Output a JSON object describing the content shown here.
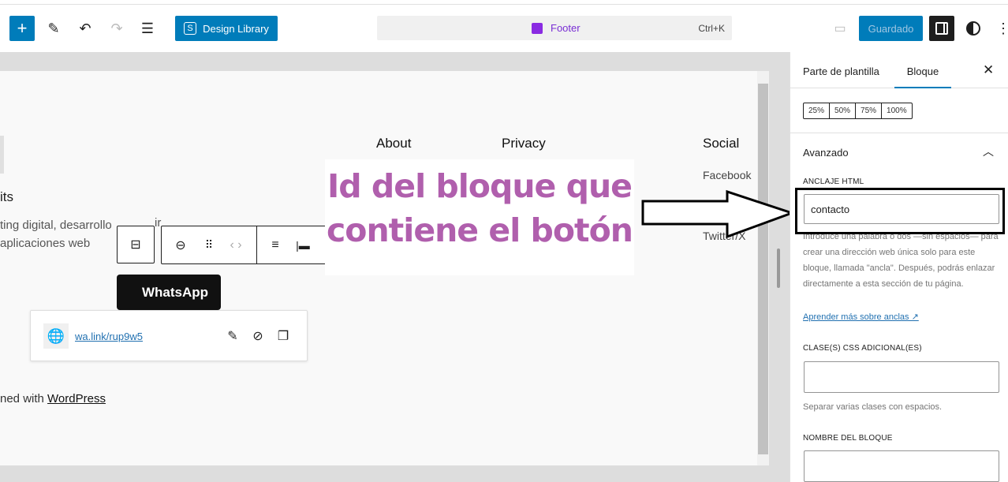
{
  "toolbar": {
    "add": "+",
    "design_library": "Design Library",
    "design_library_icon": "S",
    "command_title": "Footer",
    "shortcut": "Ctrl+K",
    "saved": "Guardado"
  },
  "canvas": {
    "heading_partial": "its",
    "text_line1": "ting digital, desarrollo",
    "text_line2": "aplicaciones web",
    "text_cut": "ir",
    "nav": [
      "About",
      "Privacy",
      "Social"
    ],
    "social_links": [
      "Facebook",
      "Twitter/X"
    ],
    "button_label": "WhatsApp",
    "link_url": "wa.link/rup9w5",
    "footer_prefix": "ned with ",
    "footer_link": "WordPress"
  },
  "annotation": {
    "text_line1": "Id del bloque que",
    "text_line2": "contiene el botón",
    "color": "#b05fad"
  },
  "sidebar": {
    "tabs": [
      "Parte de plantilla",
      "Bloque"
    ],
    "active_tab": "Bloque",
    "widths": [
      "25%",
      "50%",
      "75%",
      "100%"
    ],
    "section_title": "Avanzado",
    "anchor_label": "ANCLAJE HTML",
    "anchor_value": "contacto",
    "anchor_help": "Introduce una palabra o dos —sin espacios— para crear una dirección web única solo para este bloque, llamada \"ancla\". Después, podrás enlazar directamente a esta sección de tu página.",
    "anchor_link": "Aprender más sobre anclas",
    "css_label": "CLASE(S) CSS ADICIONAL(ES)",
    "css_value": "",
    "css_help": "Separar varias clases con espacios.",
    "name_label": "NOMBRE DEL BLOQUE",
    "name_value": ""
  },
  "colors": {
    "accent": "#007cba",
    "dark": "#1e1e1e"
  }
}
